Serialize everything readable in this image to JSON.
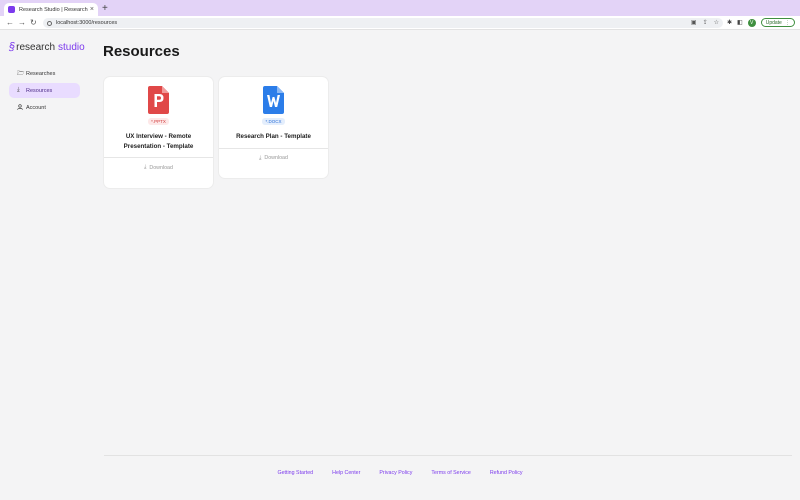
{
  "browser": {
    "tab_title": "Research Studio | Research R...",
    "url": "localhost:3000/resources",
    "update_label": "Update"
  },
  "brand": {
    "word1": "research",
    "word2": "studio"
  },
  "sidebar": {
    "items": [
      {
        "label": "Researches",
        "icon": "folder-icon",
        "active": false
      },
      {
        "label": "Resources",
        "icon": "download-icon",
        "active": true
      },
      {
        "label": "Account",
        "icon": "user-icon",
        "active": false
      }
    ]
  },
  "page": {
    "title": "Resources"
  },
  "resources": [
    {
      "badge": "*.PPTX",
      "title": "UX Interview - Remote Presentation - Template",
      "download_label": "Download",
      "icon": "pptx-file-icon",
      "color": "#e04848"
    },
    {
      "badge": "*.DOCX",
      "title": "Research Plan - Template",
      "download_label": "Download",
      "icon": "docx-file-icon",
      "color": "#2b7de9"
    }
  ],
  "footer": {
    "links": [
      "Getting Started",
      "Help Center",
      "Privacy Policy",
      "Terms of Service",
      "Refund Policy"
    ]
  }
}
